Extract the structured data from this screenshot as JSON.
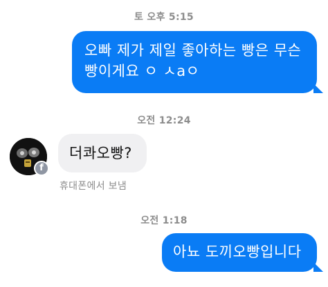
{
  "thread": {
    "timestamp_1": "토 오후 5:15",
    "message_1": "오빠 제가 제일 좋아하는 빵은 무슨",
    "message_1_line2": "빵이게요 ㅇ ㅅaㅇ",
    "timestamp_2": "오전 12:24",
    "message_2": "더콰오빵?",
    "message_2_meta": "휴대폰에서 보냄",
    "timestamp_3": "오전 1:18",
    "message_3": "아뇨 도끼오빵입니다"
  },
  "colors": {
    "outgoing_bubble": "#0a7cf5",
    "incoming_bubble": "#f0f0f2",
    "timestamp_text": "#8c8c8c"
  },
  "icons": {
    "badge": "facebook-icon",
    "badge_glyph": "f"
  }
}
